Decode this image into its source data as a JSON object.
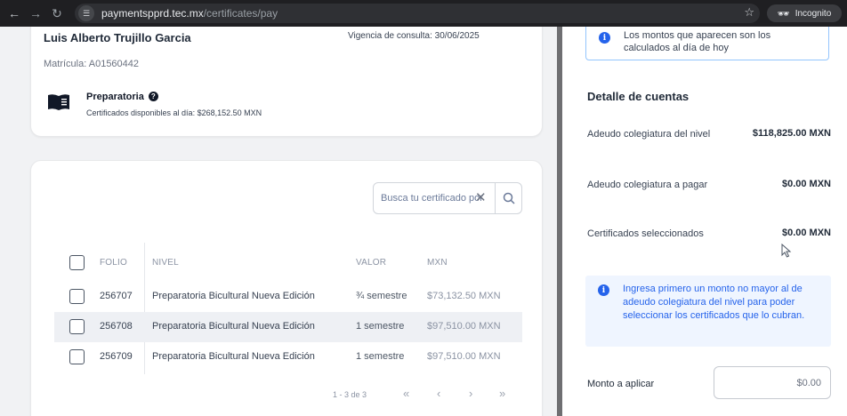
{
  "browser": {
    "domain": "paymentspprd.tec.mx",
    "path": "/certificates/pay",
    "incognito_label": "Incognito"
  },
  "student": {
    "name": "Luis Alberto Trujillo Garcia",
    "vigencia": "Vigencia de consulta: 30/06/2025",
    "matricula": "Matrícula: A01560442",
    "level": "Preparatoria",
    "available": "Certificados disponibles al día: $268,152.50 MXN"
  },
  "search": {
    "placeholder": "Busca tu certificado por"
  },
  "table": {
    "headers": {
      "folio": "FOLIO",
      "nivel": "NIVEL",
      "valor": "VALOR",
      "mxn": "MXN"
    },
    "rows": [
      {
        "folio": "256707",
        "nivel": "Preparatoria Bicultural Nueva Edición",
        "valor": "¾ semestre",
        "mxn": "$73,132.50 MXN"
      },
      {
        "folio": "256708",
        "nivel": "Preparatoria Bicultural Nueva Edición",
        "valor": "1 semestre",
        "mxn": "$97,510.00 MXN"
      },
      {
        "folio": "256709",
        "nivel": "Preparatoria Bicultural Nueva Edición",
        "valor": "1 semestre",
        "mxn": "$97,510.00 MXN"
      }
    ],
    "pagination": {
      "range": "1 - 3 de 3",
      "first": "«",
      "prev": "‹",
      "next": "›",
      "last": "»"
    }
  },
  "panel": {
    "info_top": "Los montos que aparecen son los calculados al día de hoy",
    "section_title": "Detalle de cuentas",
    "accounts": [
      {
        "label": "Adeudo colegiatura del nivel",
        "value": "$118,825.00 MXN"
      },
      {
        "label": "Adeudo colegiatura a pagar",
        "value": "$0.00 MXN"
      },
      {
        "label": "Certificados seleccionados",
        "value": "$0.00 MXN"
      }
    ],
    "info_mid": "Ingresa primero un monto no mayor al de adeudo colegiatura del nivel para poder seleccionar los certificados que lo cubran.",
    "monto_label": "Monto a aplicar",
    "monto_placeholder": "$0.00"
  },
  "colors": {
    "accent": "#2563eb",
    "info_bg": "#eff5ff",
    "chrome_bg": "#1f1f22"
  }
}
